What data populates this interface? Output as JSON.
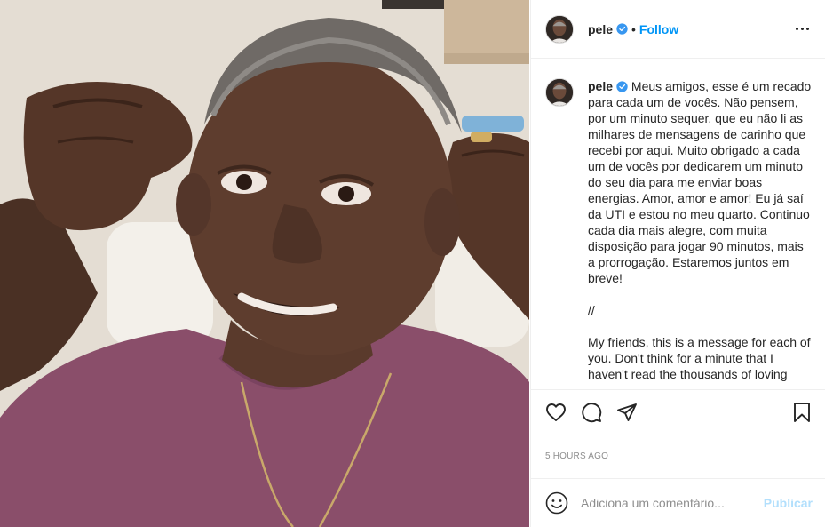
{
  "post": {
    "username": "pele",
    "verified": true,
    "follow_label": "Follow",
    "dot_separator": "•",
    "image_alt_icon": "photo-image"
  },
  "caption": {
    "username": "pele",
    "paragraphs": [
      "Meus amigos, esse é um recado para cada um de vocês. Não pensem, por um minuto sequer, que eu não li as milhares de mensagens de carinho que recebi por aqui. Muito obrigado a cada um de vocês por dedicarem um minuto do seu dia para me enviar boas energias. Amor, amor e amor! Eu já saí da UTI e estou no meu quarto. Continuo cada dia mais alegre, com muita disposição para jogar 90 minutos, mais a prorrogação. Estaremos juntos em breve!",
      "//",
      "My friends, this is a message for each of you. Don't think for a minute that I haven't read the thousands of loving"
    ]
  },
  "actions": {
    "icons": [
      "heart-icon",
      "comment-icon",
      "share-icon",
      "bookmark-icon"
    ]
  },
  "timestamp": "5 HOURS AGO",
  "comment": {
    "placeholder": "Adiciona um comentário...",
    "publish_label": "Publicar",
    "emoji_icon": "smiley-icon"
  },
  "colors": {
    "link_blue": "#0095f6",
    "publish_disabled": "#b2dffc",
    "border": "#efefef",
    "muted_text": "#8e8e8e",
    "shirt": "#8a4e6a"
  }
}
